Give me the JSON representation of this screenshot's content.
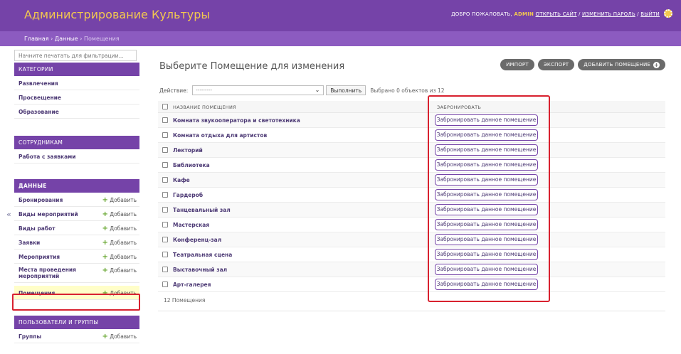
{
  "header": {
    "site_name": "Администрирование Культуры",
    "welcome": "ДОБРО ПОЖАЛОВАТЬ,",
    "username": "ADMIN",
    "view_site": "ОТКРЫТЬ САЙТ",
    "change_password": "ИЗМЕНИТЬ ПАРОЛЬ",
    "logout": "ВЫЙТИ",
    "separator": " / "
  },
  "breadcrumbs": {
    "home": "Главная",
    "app": "Данные",
    "current": "Помещения",
    "sep": " › "
  },
  "sidebar": {
    "filter_placeholder": "Начните печатать для фильтрации...",
    "add_label": "Добавить",
    "collapse_symbol": "«",
    "modules": [
      {
        "caption": "КАТЕГОРИИ",
        "items": [
          "Развлечения",
          "Просвещение",
          "Образование"
        ]
      },
      {
        "caption": "СОТРУДНИКАМ",
        "items": [
          "Работа с заявками"
        ]
      },
      {
        "caption": "ДАННЫЕ",
        "items": [
          "Бронирования",
          "Виды мероприятий",
          "Виды работ",
          "Заявки",
          "Мероприятия",
          "Места проведения мероприятий",
          "Помещения"
        ]
      },
      {
        "caption": "ПОЛЬЗОВАТЕЛИ И ГРУППЫ",
        "items": [
          "Группы"
        ]
      }
    ]
  },
  "content": {
    "title": "Выберите Помещение для изменения",
    "tools": {
      "import": "ИМПОРТ",
      "export": "ЭКСПОРТ",
      "add": "ДОБАВИТЬ ПОМЕЩЕНИЕ"
    },
    "actions": {
      "label": "Действие:",
      "select_value": "---------",
      "go": "Выполнить",
      "counter": "Выбрано 0 объектов из 12"
    },
    "columns": {
      "name": "НАЗВАНИЕ ПОМЕЩЕНИЯ",
      "book": "ЗАБРОНИРОВАТЬ"
    },
    "book_label": "Забронировать данное помещение",
    "rows": [
      "Комната звукооператора и светотехника",
      "Комната отдыха для артистов",
      "Лекторий",
      "Библиотека",
      "Кафе",
      "Гардероб",
      "Танцевальный зал",
      "Мастерская",
      "Конференц-зал",
      "Театральная сцена",
      "Выставочный зал",
      "Арт-галерея"
    ],
    "paginator": "12 Помещения"
  },
  "colors": {
    "header_bg": "#7543a8",
    "breadcrumb_bg": "#8c5bc0",
    "site_name": "#f3c84f",
    "highlight_border": "#d8212f",
    "selected_row": "#fffec8",
    "add_plus": "#5fa225"
  }
}
